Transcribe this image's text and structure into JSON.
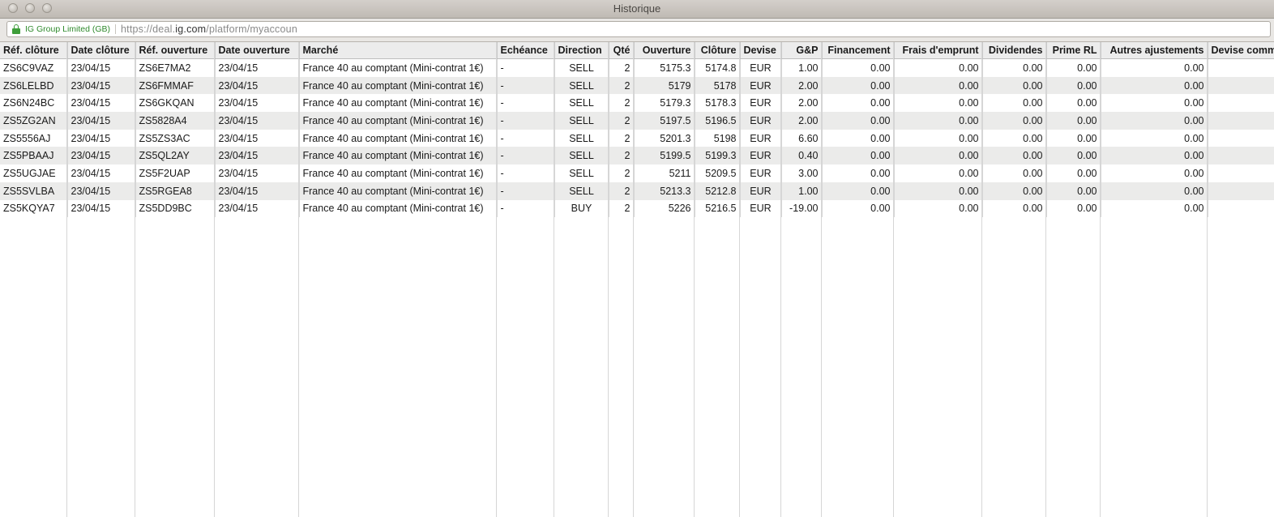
{
  "window": {
    "title": "Historique"
  },
  "urlbar": {
    "cert_label": "IG Group Limited (GB)",
    "url_prefix": "https://deal.",
    "url_host": "ig.com",
    "url_path": "/platform/myaccoun"
  },
  "table": {
    "columns": [
      "Réf. clôture",
      "Date clôture",
      "Réf. ouverture",
      "Date ouverture",
      "Marché",
      "Echéance",
      "Direction",
      "Qté",
      "Ouverture",
      "Clôture",
      "Devise",
      "G&P",
      "Financement",
      "Frais d'emprunt",
      "Dividendes",
      "Prime RL",
      "Autres ajustements",
      "Devise comm"
    ],
    "rows": [
      [
        "ZS6C9VAZ",
        "23/04/15",
        "ZS6E7MA2",
        "23/04/15",
        "France 40 au comptant (Mini-contrat 1€)",
        "-",
        "SELL",
        "2",
        "5175.3",
        "5174.8",
        "EUR",
        "1.00",
        "0.00",
        "0.00",
        "0.00",
        "0.00",
        "0.00",
        ""
      ],
      [
        "ZS6LELBD",
        "23/04/15",
        "ZS6FMMAF",
        "23/04/15",
        "France 40 au comptant (Mini-contrat 1€)",
        "-",
        "SELL",
        "2",
        "5179",
        "5178",
        "EUR",
        "2.00",
        "0.00",
        "0.00",
        "0.00",
        "0.00",
        "0.00",
        ""
      ],
      [
        "ZS6N24BC",
        "23/04/15",
        "ZS6GKQAN",
        "23/04/15",
        "France 40 au comptant (Mini-contrat 1€)",
        "-",
        "SELL",
        "2",
        "5179.3",
        "5178.3",
        "EUR",
        "2.00",
        "0.00",
        "0.00",
        "0.00",
        "0.00",
        "0.00",
        ""
      ],
      [
        "ZS5ZG2AN",
        "23/04/15",
        "ZS5828A4",
        "23/04/15",
        "France 40 au comptant (Mini-contrat 1€)",
        "-",
        "SELL",
        "2",
        "5197.5",
        "5196.5",
        "EUR",
        "2.00",
        "0.00",
        "0.00",
        "0.00",
        "0.00",
        "0.00",
        ""
      ],
      [
        "ZS5556AJ",
        "23/04/15",
        "ZS5ZS3AC",
        "23/04/15",
        "France 40 au comptant (Mini-contrat 1€)",
        "-",
        "SELL",
        "2",
        "5201.3",
        "5198",
        "EUR",
        "6.60",
        "0.00",
        "0.00",
        "0.00",
        "0.00",
        "0.00",
        ""
      ],
      [
        "ZS5PBAAJ",
        "23/04/15",
        "ZS5QL2AY",
        "23/04/15",
        "France 40 au comptant (Mini-contrat 1€)",
        "-",
        "SELL",
        "2",
        "5199.5",
        "5199.3",
        "EUR",
        "0.40",
        "0.00",
        "0.00",
        "0.00",
        "0.00",
        "0.00",
        ""
      ],
      [
        "ZS5UGJAE",
        "23/04/15",
        "ZS5F2UAP",
        "23/04/15",
        "France 40 au comptant (Mini-contrat 1€)",
        "-",
        "SELL",
        "2",
        "5211",
        "5209.5",
        "EUR",
        "3.00",
        "0.00",
        "0.00",
        "0.00",
        "0.00",
        "0.00",
        ""
      ],
      [
        "ZS5SVLBA",
        "23/04/15",
        "ZS5RGEA8",
        "23/04/15",
        "France 40 au comptant (Mini-contrat 1€)",
        "-",
        "SELL",
        "2",
        "5213.3",
        "5212.8",
        "EUR",
        "1.00",
        "0.00",
        "0.00",
        "0.00",
        "0.00",
        "0.00",
        ""
      ],
      [
        "ZS5KQYA7",
        "23/04/15",
        "ZS5DD9BC",
        "23/04/15",
        "France 40 au comptant (Mini-contrat 1€)",
        "-",
        "BUY",
        "2",
        "5226",
        "5216.5",
        "EUR",
        "-19.00",
        "0.00",
        "0.00",
        "0.00",
        "0.00",
        "0.00",
        ""
      ]
    ]
  }
}
